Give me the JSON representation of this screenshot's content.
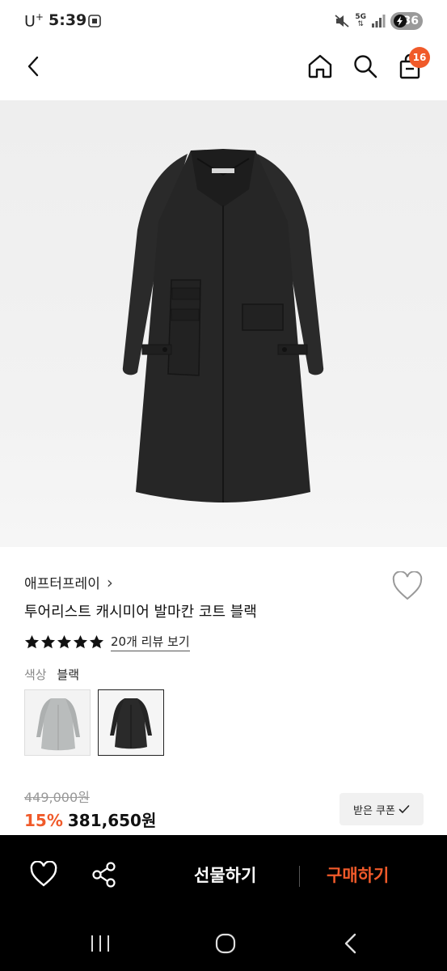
{
  "status_bar": {
    "carrier": "U",
    "carrier_sup": "+",
    "time": "5:39",
    "network": "5G",
    "battery": "36"
  },
  "header": {
    "cart_count": "16",
    "icons": [
      "back-icon",
      "home-icon",
      "search-icon",
      "shopping-bag-icon"
    ]
  },
  "product": {
    "brand": "애프터프레이",
    "brand_chevron": "›",
    "title": "투어리스트 캐시미어 발마칸 코트 블랙",
    "rating_stars": 5,
    "review_link": "20개 리뷰 보기",
    "color_label": "색상",
    "color_value": "블랙",
    "swatches": [
      "light grey coat",
      "black coat (selected)"
    ],
    "original_price": "449,000원",
    "discount": "15%",
    "price": "381,650원",
    "coupon_label": "받은 쿠폰",
    "coupon_icon": "check-icon"
  },
  "action_bar": {
    "gift_label": "선물하기",
    "buy_label": "구매하기"
  },
  "colors": {
    "accent": "#f05a2a",
    "action_bar_bg": "#000000",
    "text_primary": "#111111",
    "text_muted": "#888888"
  }
}
